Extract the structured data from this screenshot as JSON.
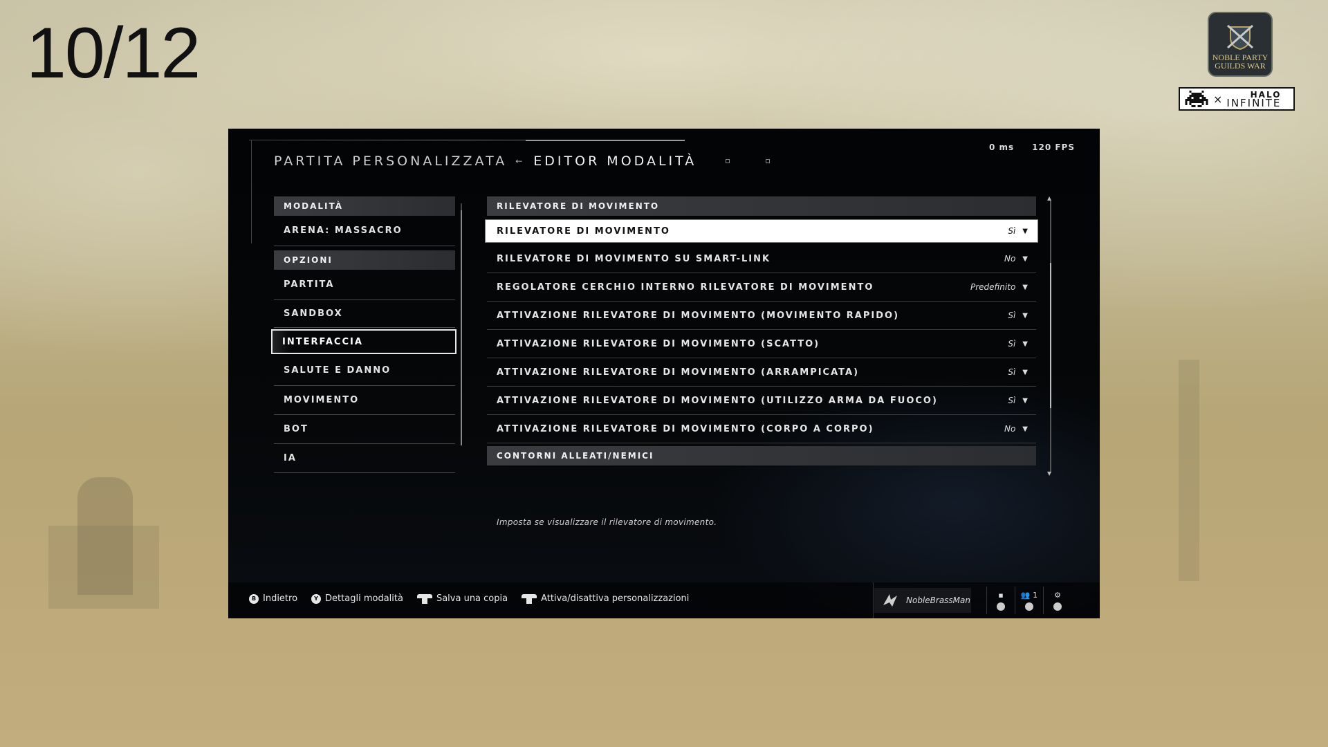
{
  "slide": {
    "number": "10/12"
  },
  "logos": {
    "guild_line1": "NOBLE PARTY",
    "guild_line2": "GUILDS WAR",
    "halo_top": "HALO",
    "halo_bottom": "INFINITE"
  },
  "header": {
    "parent": "PARTITA PERSONALIZZATA",
    "title": "EDITOR MODALITÀ"
  },
  "perf": {
    "ping": "0 ms",
    "fps": "120 FPS"
  },
  "left_menu": {
    "mode_header": "MODALITÀ",
    "mode_value": "ARENA: MASSACRO",
    "options_header": "OPZIONI",
    "items": [
      {
        "label": "PARTITA"
      },
      {
        "label": "SANDBOX"
      },
      {
        "label": "INTERFACCIA"
      },
      {
        "label": "SALUTE E DANNO"
      },
      {
        "label": "MOVIMENTO"
      },
      {
        "label": "BOT"
      },
      {
        "label": "IA"
      }
    ],
    "selected_index": 2
  },
  "settings": {
    "section_header": "RILEVATORE DI MOVIMENTO",
    "rows": [
      {
        "label": "RILEVATORE DI MOVIMENTO",
        "value": "Sì"
      },
      {
        "label": "RILEVATORE DI MOVIMENTO SU SMART-LINK",
        "value": "No"
      },
      {
        "label": "REGOLATORE CERCHIO INTERNO RILEVATORE DI MOVIMENTO",
        "value": "Predefinito"
      },
      {
        "label": "ATTIVAZIONE RILEVATORE DI MOVIMENTO (MOVIMENTO RAPIDO)",
        "value": "Sì"
      },
      {
        "label": "ATTIVAZIONE RILEVATORE DI MOVIMENTO (SCATTO)",
        "value": "Sì"
      },
      {
        "label": "ATTIVAZIONE RILEVATORE DI MOVIMENTO (ARRAMPICATA)",
        "value": "Sì"
      },
      {
        "label": "ATTIVAZIONE RILEVATORE DI MOVIMENTO (UTILIZZO ARMA DA FUOCO)",
        "value": "Sì"
      },
      {
        "label": "ATTIVAZIONE RILEVATORE DI MOVIMENTO (CORPO A CORPO)",
        "value": "No"
      }
    ],
    "next_section_header": "CONTORNI ALLEATI/NEMICI"
  },
  "description": "Imposta se visualizzare il rilevatore di movimento.",
  "footer": {
    "hints": [
      {
        "glyph": "B",
        "label": "Indietro"
      },
      {
        "glyph": "Y",
        "label": "Dettagli modalità"
      },
      {
        "glyph": "LB",
        "label": "Salva una copia"
      },
      {
        "glyph": "RB",
        "label": "Attiva/disattiva personalizzazioni"
      }
    ],
    "player_name": "NobleBrassMan",
    "party_count": "1"
  },
  "colors": {
    "panel_bg": "#050709",
    "selected_bg": "#ffffff",
    "header_bar": "#34363a"
  }
}
